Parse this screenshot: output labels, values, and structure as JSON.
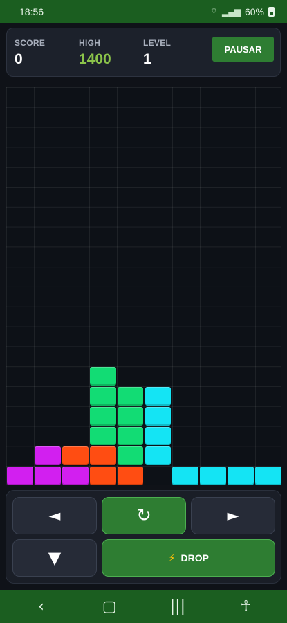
{
  "status_bar": {
    "time": "18:56",
    "battery": "60%",
    "icons": [
      "wifi-icon",
      "signal-icon",
      "battery-icon"
    ]
  },
  "score_panel": {
    "score_label": "SCORE",
    "score_value": "0",
    "high_label": "HIGH",
    "high_value": "1400",
    "level_label": "LEVEL",
    "level_value": "1",
    "pause_label": "PAUSAR"
  },
  "board": {
    "columns": 10,
    "rows": 20,
    "colors": {
      "M": "#d21ff0",
      "O": "#ff4d12",
      "G": "#12dc74",
      "C": "#14e4f4"
    },
    "cells": [
      "..........",
      "..........",
      "..........",
      "..........",
      "..........",
      "..........",
      "..........",
      "..........",
      "..........",
      "..........",
      "..........",
      "..........",
      "..........",
      "..........",
      "...G......",
      "...GGC....",
      "...GGC....",
      "...GGC....",
      ".MOOGC....",
      "MMMOO.CCCC"
    ]
  },
  "controls": {
    "left_icon": "arrow-left-icon",
    "rotate_icon": "rotate-icon",
    "right_icon": "arrow-right-icon",
    "down_icon": "arrow-down-icon",
    "drop_icon": "lightning-icon",
    "drop_label": "DROP"
  },
  "nav_bar": {
    "icons": [
      "back-icon",
      "home-icon",
      "recents-icon",
      "accessibility-icon"
    ]
  }
}
